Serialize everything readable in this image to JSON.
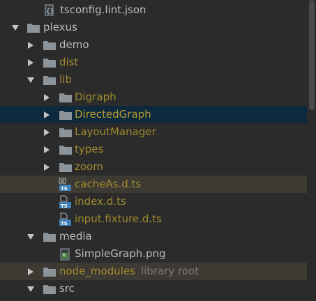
{
  "colors": {
    "background": "#2b2b2b",
    "selected_row": "#0d293e",
    "highlight_row": "#3c3a33",
    "text_default": "#bbbbbb",
    "text_ignored": "#a08a2e",
    "text_muted": "#787878",
    "folder_icon": "#8c9399"
  },
  "tree": {
    "items": [
      {
        "label": "tsconfig.lint.json",
        "icon": "json-file-icon"
      },
      {
        "label": "plexus",
        "icon": "folder-icon",
        "expanded": true
      },
      {
        "label": "demo",
        "icon": "folder-icon",
        "expanded": false
      },
      {
        "label": "dist",
        "icon": "folder-icon",
        "expanded": false
      },
      {
        "label": "lib",
        "icon": "folder-icon",
        "expanded": true
      },
      {
        "label": "Digraph",
        "icon": "folder-icon",
        "expanded": false
      },
      {
        "label": "DirectedGraph",
        "icon": "folder-icon",
        "expanded": false
      },
      {
        "label": "LayoutManager",
        "icon": "folder-icon",
        "expanded": false
      },
      {
        "label": "types",
        "icon": "folder-icon",
        "expanded": false
      },
      {
        "label": "zoom",
        "icon": "folder-icon",
        "expanded": false
      },
      {
        "label": "cacheAs.d.ts",
        "icon": "ts-file-error-icon"
      },
      {
        "label": "index.d.ts",
        "icon": "ts-file-icon"
      },
      {
        "label": "input.fixture.d.ts",
        "icon": "ts-file-icon"
      },
      {
        "label": "media",
        "icon": "folder-icon",
        "expanded": true
      },
      {
        "label": "SimpleGraph.png",
        "icon": "image-file-icon"
      },
      {
        "label": "node_modules",
        "sublabel": "library root",
        "icon": "folder-icon",
        "expanded": false
      },
      {
        "label": "src",
        "icon": "folder-icon",
        "expanded": true
      }
    ]
  }
}
